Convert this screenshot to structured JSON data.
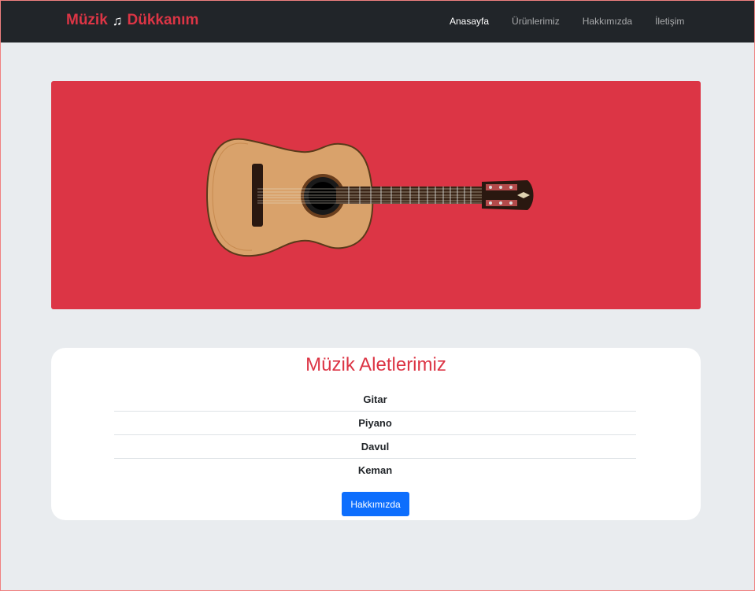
{
  "navbar": {
    "brand_left": "Müzik",
    "brand_icon": "music-note-icon",
    "brand_right": "Dükkanım",
    "links": [
      "Anasayfa",
      "Ürünlerimiz",
      "Hakkımızda",
      "İletişim"
    ],
    "active_link": "Anasayfa"
  },
  "hero": {
    "image": "classical-guitar",
    "background": "#dc3545"
  },
  "instruments": {
    "title": "Müzik Aletlerimiz",
    "items": [
      "Gitar",
      "Piyano",
      "Davul",
      "Keman"
    ],
    "button_label": "Hakkımızda"
  },
  "colors": {
    "accent": "#dc3545",
    "primary": "#0d6efd",
    "navbar": "#212529",
    "page": "#e9ecef"
  }
}
